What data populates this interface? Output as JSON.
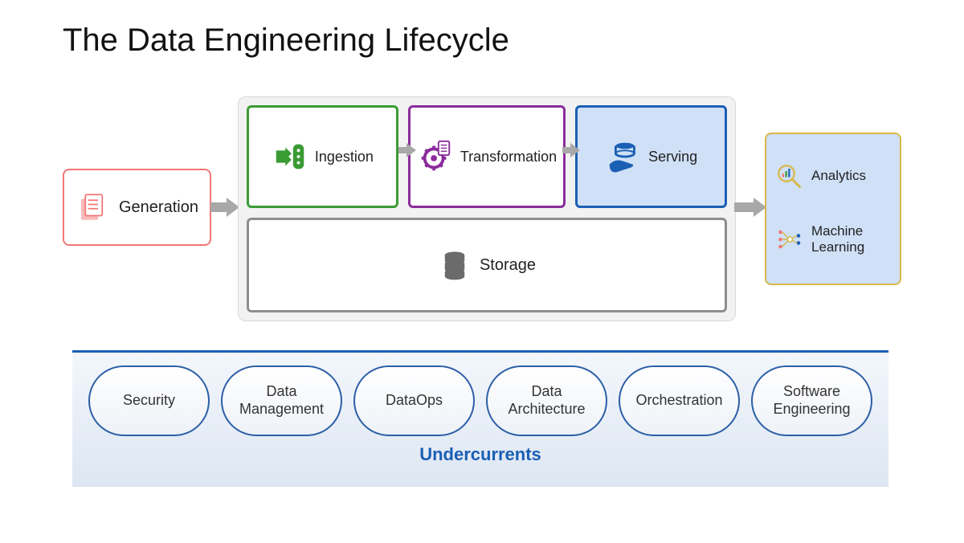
{
  "title": "The Data Engineering Lifecycle",
  "generation": {
    "label": "Generation",
    "icon": "document-icon",
    "color": "#f37676"
  },
  "core": {
    "stages": [
      {
        "label": "Ingestion",
        "icon": "ingestion-icon",
        "color": "#3a9b34"
      },
      {
        "label": "Transformation",
        "icon": "gear-icon",
        "color": "#8a2c9b"
      },
      {
        "label": "Serving",
        "icon": "serve-icon",
        "color": "#1b5fb5"
      }
    ],
    "storage": {
      "label": "Storage",
      "icon": "database-icon",
      "color": "#8e8e8e"
    }
  },
  "outputs": [
    {
      "label": "Analytics",
      "icon": "magnifier-chart-icon"
    },
    {
      "label": "Machine Learning",
      "icon": "ml-network-icon"
    }
  ],
  "undercurrents": {
    "label": "Undercurrents",
    "items": [
      "Security",
      "Data Management",
      "DataOps",
      "Data Architecture",
      "Orchestration",
      "Software Engineering"
    ]
  }
}
